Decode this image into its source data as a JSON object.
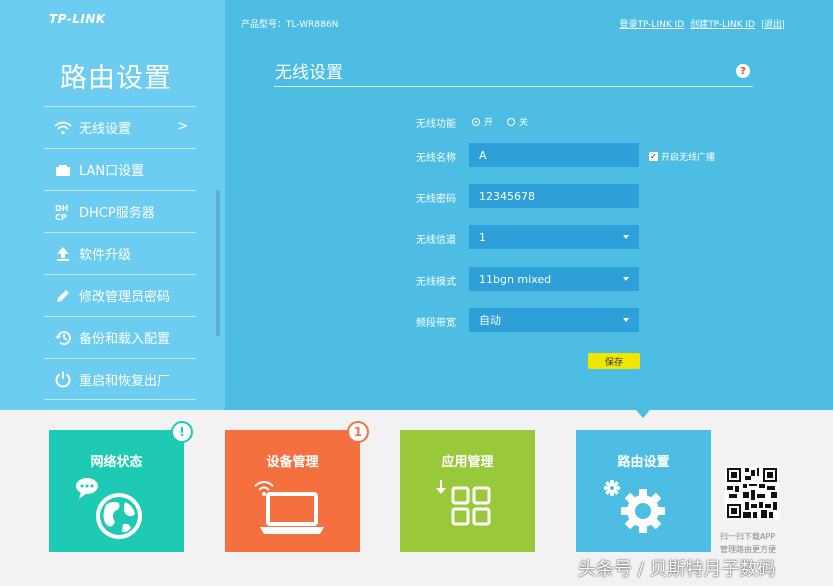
{
  "brand": "TP-LINK",
  "sidebar": {
    "title": "路由设置",
    "items": [
      {
        "label": "无线设置",
        "arrow": ">"
      },
      {
        "label": "LAN口设置"
      },
      {
        "label": "DHCP服务器"
      },
      {
        "label": "软件升级"
      },
      {
        "label": "修改管理员密码"
      },
      {
        "label": "备份和载入配置"
      },
      {
        "label": "重启和恢复出厂"
      }
    ]
  },
  "header": {
    "model": "产品型号：TL-WR886N",
    "links": [
      "登录TP-LINK ID",
      "创建TP-LINK ID",
      "|退出|"
    ]
  },
  "panel": {
    "title": "无线设置",
    "help": "?",
    "wireless_function": {
      "label": "无线功能",
      "on": "开",
      "off": "关",
      "selected": "开"
    },
    "ssid": {
      "label": "无线名称",
      "value": "A"
    },
    "broadcast": {
      "label": "开启无线广播",
      "checked": true,
      "mark": "✓"
    },
    "password": {
      "label": "无线密码",
      "value": "12345678"
    },
    "channel": {
      "label": "无线信道",
      "value": "1"
    },
    "mode": {
      "label": "无线模式",
      "value": "11bgn mixed"
    },
    "bandwidth": {
      "label": "频段带宽",
      "value": "自动"
    },
    "save_label": "保存"
  },
  "tiles": [
    {
      "label": "网络状态",
      "color": "#1ecab3",
      "badge": "!",
      "badge_color": "#1ecab3"
    },
    {
      "label": "设备管理",
      "color": "#f4703f",
      "badge": "1",
      "badge_color": "#f4703f"
    },
    {
      "label": "应用管理",
      "color": "#99c93a"
    },
    {
      "label": "路由设置",
      "color": "#4dbde4"
    }
  ],
  "qr": {
    "line1": "扫一扫下载APP",
    "line2": "管理路由更方便"
  },
  "watermark": "头条号 / 贝斯特月子数码"
}
